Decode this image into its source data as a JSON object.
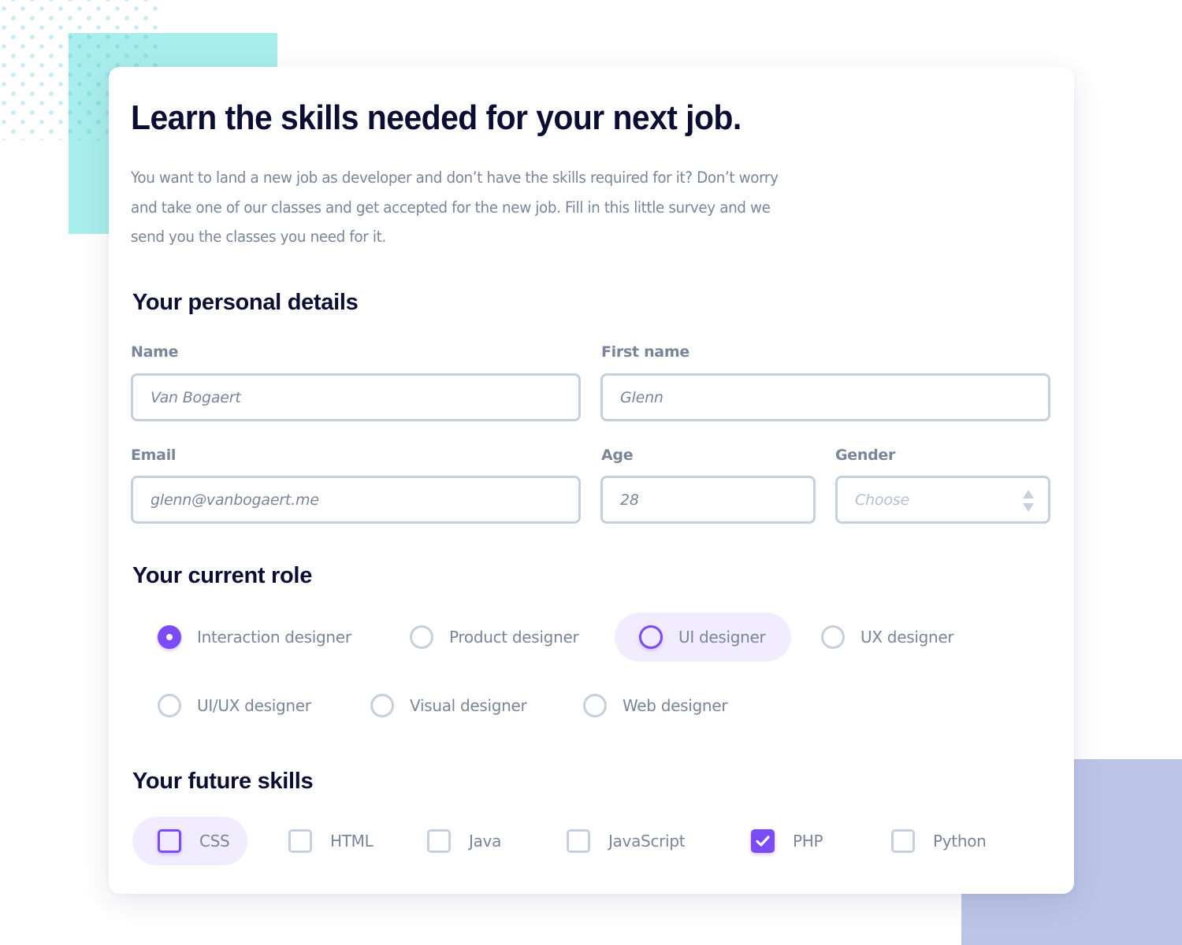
{
  "theme": {
    "accent": "#7b4cf5",
    "accent_soft": "#f1edfe",
    "heading": "#0b0d33",
    "muted_text": "#7a8599",
    "border": "#c8cfdc",
    "teal_decor": "#a8eeec",
    "lavender_decor": "#bcc5e7"
  },
  "header": {
    "title": "Learn the skills needed for your next job.",
    "intro_lines": [
      "You want to land a new job as developer and don’t have the skills required for it? Don’t worry",
      "and take one of our classes and get accepted for the new job. Fill in this little survey and we",
      "send you the classes you need for it."
    ]
  },
  "personal": {
    "title": "Your personal details",
    "name": {
      "label": "Name",
      "value": "Van Bogaert"
    },
    "first_name": {
      "label": "First name",
      "value": "Glenn"
    },
    "email": {
      "label": "Email",
      "value": "glenn@vanbogaert.me"
    },
    "age": {
      "label": "Age",
      "value": "28"
    },
    "gender": {
      "label": "Gender",
      "placeholder": "Choose",
      "icon": "up-down-arrows-icon"
    }
  },
  "role": {
    "title": "Your current role",
    "options": [
      {
        "label": "Interaction designer",
        "state": "checked"
      },
      {
        "label": "Product designer",
        "state": "unchecked"
      },
      {
        "label": "UI designer",
        "state": "focused"
      },
      {
        "label": "UX designer",
        "state": "unchecked"
      },
      {
        "label": "UI/UX designer",
        "state": "unchecked"
      },
      {
        "label": "Visual designer",
        "state": "unchecked"
      },
      {
        "label": "Web designer",
        "state": "unchecked"
      }
    ]
  },
  "skills": {
    "title": "Your future skills",
    "options": [
      {
        "label": "CSS",
        "state": "focused"
      },
      {
        "label": "HTML",
        "state": "unchecked"
      },
      {
        "label": "Java",
        "state": "unchecked"
      },
      {
        "label": "JavaScript",
        "state": "unchecked"
      },
      {
        "label": "PHP",
        "state": "checked"
      },
      {
        "label": "Python",
        "state": "unchecked"
      }
    ]
  }
}
